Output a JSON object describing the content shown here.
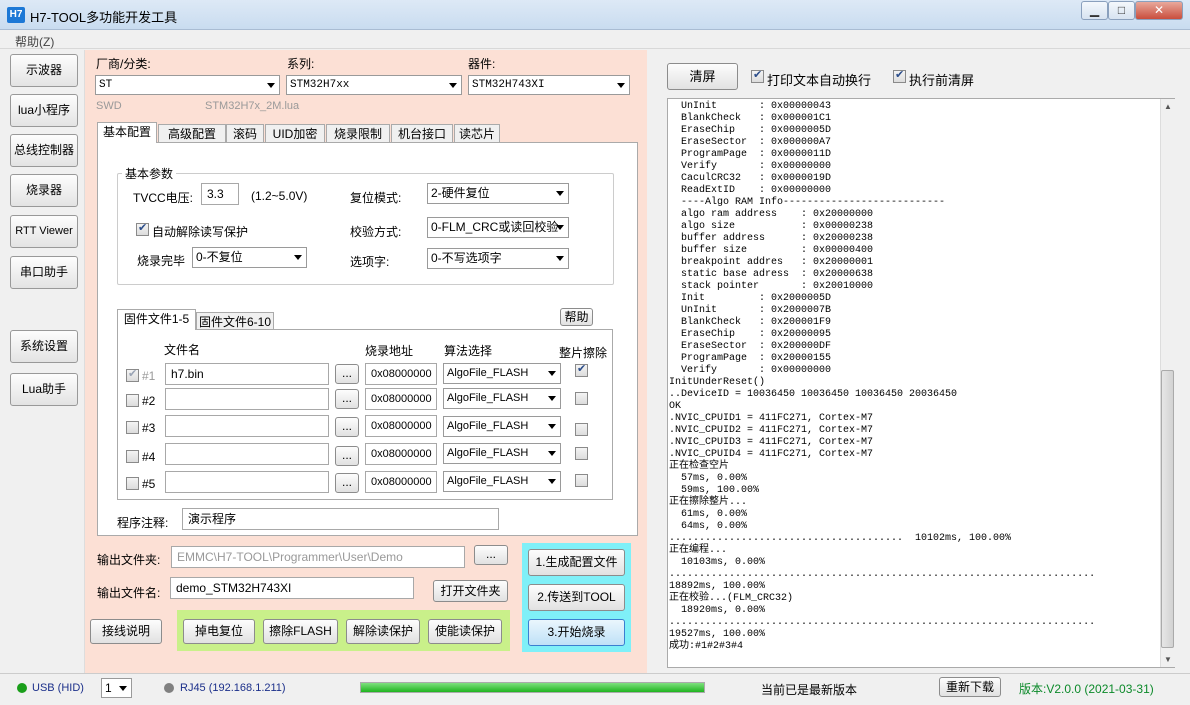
{
  "window": {
    "icon_text": "H7",
    "title": "H7-TOOL多功能开发工具",
    "minimize": "▁",
    "maximize": "□",
    "close": "✕"
  },
  "menu": {
    "help": "帮助(Z)"
  },
  "nav": {
    "oscilloscope": "示波器",
    "lua_program": "lua小程序",
    "bus_controller": "总线控制器",
    "programmer": "烧录器",
    "rtt_viewer": "RTT Viewer",
    "serial_assistant": "串口助手",
    "system_settings": "系统设置",
    "lua_assistant": "Lua助手"
  },
  "device": {
    "vendor_label": "厂商/分类:",
    "vendor_value": "ST",
    "series_label": "系列:",
    "series_value": "STM32H7xx",
    "chip_label": "器件:",
    "chip_value": "STM32H743XI",
    "interface": "SWD",
    "lua_file": "STM32H7x_2M.lua"
  },
  "tabs": {
    "basic": "基本配置",
    "advanced": "高级配置",
    "rolling_code": "滚码",
    "uid_encrypt": "UID加密",
    "burn_limit": "烧录限制",
    "machine_interface": "机台接口",
    "read_chip": "读芯片"
  },
  "basic": {
    "group_title": "基本参数",
    "tvcc_label": "TVCC电压:",
    "tvcc_value": "3.3",
    "tvcc_range": "(1.2~5.0V)",
    "reset_label": "复位模式:",
    "reset_value": "2-硬件复位",
    "auto_unprotect_label": "自动解除读写保护",
    "auto_unprotect_checked": true,
    "verify_label": "校验方式:",
    "verify_value": "0-FLM_CRC或读回校验",
    "after_burn_label": "烧录完毕",
    "after_burn_value": "0-不复位",
    "option_label": "选项字:",
    "option_value": "0-不写选项字"
  },
  "firmware": {
    "tab1": "固件文件1-5",
    "tab2": "固件文件6-10",
    "help_button": "帮助",
    "col_filename": "文件名",
    "col_address": "烧录地址",
    "col_algo": "算法选择",
    "col_chip_erase": "整片擦除",
    "browse": "...",
    "rows": [
      {
        "num": "#1",
        "checked": true,
        "file": "h7.bin",
        "address": "0x08000000",
        "algo": "AlgoFile_FLASH",
        "erase": true
      },
      {
        "num": "#2",
        "checked": false,
        "file": "",
        "address": "0x08000000",
        "algo": "AlgoFile_FLASH",
        "erase": false
      },
      {
        "num": "#3",
        "checked": false,
        "file": "",
        "address": "0x08000000",
        "algo": "AlgoFile_FLASH",
        "erase": false
      },
      {
        "num": "#4",
        "checked": false,
        "file": "",
        "address": "0x08000000",
        "algo": "AlgoFile_FLASH",
        "erase": false
      },
      {
        "num": "#5",
        "checked": false,
        "file": "",
        "address": "0x08000000",
        "algo": "AlgoFile_FLASH",
        "erase": false
      }
    ],
    "note_label": "程序注释:",
    "note_value": "演示程序"
  },
  "output": {
    "folder_label": "输出文件夹:",
    "folder_value": "EMMC\\H7-TOOL\\Programmer\\User\\Demo",
    "browse": "...",
    "name_label": "输出文件名:",
    "name_value": "demo_STM32H743XI",
    "open_folder": "打开文件夹"
  },
  "actions": {
    "wiring": "接线说明",
    "power_reset": "掉电复位",
    "erase_flash": "擦除FLASH",
    "remove_protect": "解除读保护",
    "enable_protect": "使能读保护",
    "gen_config": "1.生成配置文件",
    "send_tool": "2.传送到TOOL",
    "start_burn": "3.开始烧录"
  },
  "log": {
    "clear": "清屏",
    "auto_wrap": "打印文本自动换行",
    "auto_wrap_checked": true,
    "clear_before": "执行前清屏",
    "clear_before_checked": true,
    "text": "  UnInit       : 0x00000043\n  BlankCheck   : 0x000001C1\n  EraseChip    : 0x0000005D\n  EraseSector  : 0x000000A7\n  ProgramPage  : 0x0000011D\n  Verify       : 0x00000000\n  CaculCRC32   : 0x0000019D\n  ReadExtID    : 0x00000000\n  ----Algo RAM Info---------------------------\n  algo ram address    : 0x20000000\n  algo size           : 0x00000238\n  buffer address      : 0x20000238\n  buffer size         : 0x00000400\n  breakpoint addres   : 0x20000001\n  static base adress  : 0x20000638\n  stack pointer       : 0x20010000\n  Init         : 0x2000005D\n  UnInit       : 0x2000007B\n  BlankCheck   : 0x200001F9\n  EraseChip    : 0x20000095\n  EraseSector  : 0x200000DF\n  ProgramPage  : 0x20000155\n  Verify       : 0x00000000\nInitUnderReset()\n..DeviceID = 10036450 10036450 10036450 20036450\nOK\n.NVIC_CPUID1 = 411FC271, Cortex-M7\n.NVIC_CPUID2 = 411FC271, Cortex-M7\n.NVIC_CPUID3 = 411FC271, Cortex-M7\n.NVIC_CPUID4 = 411FC271, Cortex-M7\n正在检查空片\n  57ms, 0.00%\n  59ms, 100.00%\n正在擦除整片...\n  61ms, 0.00%\n  64ms, 0.00%\n.......................................  10102ms, 100.00%\n正在编程...\n  10103ms, 0.00%\n.......................................................................\n18892ms, 100.00%\n正在校验...(FLM_CRC32)\n  18920ms, 0.00%\n.......................................................................\n19527ms, 100.00%\n成功:#1#2#3#4"
  },
  "status": {
    "usb_label": "USB (HID)",
    "usb_color": "#1a9e1a",
    "usb_index": "1",
    "rj45_label": "RJ45 (192.168.1.211)",
    "rj45_color": "#808080",
    "progress_percent": 100,
    "update_msg": "当前已是最新版本",
    "redownload": "重新下载",
    "version": "版本:V2.0.0 (2021-03-31)"
  }
}
